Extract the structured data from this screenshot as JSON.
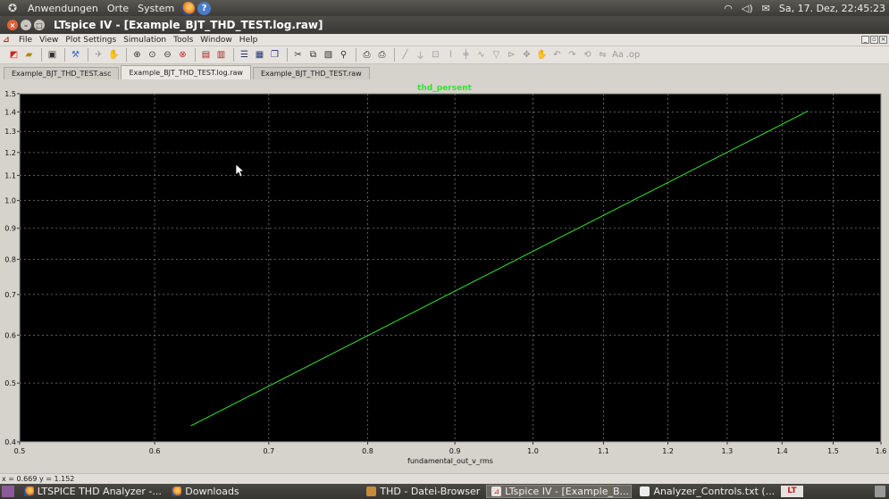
{
  "top_panel": {
    "menus": [
      "Anwendungen",
      "Orte",
      "System"
    ],
    "clock": "Sa, 17. Dez, 22:45:23"
  },
  "window": {
    "title": "LTspice IV - [Example_BJT_THD_TEST.log.raw]"
  },
  "menubar": {
    "items": [
      "File",
      "View",
      "Plot Settings",
      "Simulation",
      "Tools",
      "Window",
      "Help"
    ]
  },
  "tabs": [
    {
      "label": "Example_BJT_THD_TEST.asc",
      "active": false
    },
    {
      "label": "Example_BJT_THD_TEST.log.raw",
      "active": true
    },
    {
      "label": "Example_BJT_THD_TEST.raw",
      "active": false
    }
  ],
  "statusbar": {
    "cursor_readout": "x = 0.669   y = 1.152"
  },
  "taskbar": {
    "tasks": [
      {
        "label": "LTSPICE THD Analyzer -...",
        "active": false
      },
      {
        "label": "Downloads",
        "active": false
      },
      {
        "label": "THD - Datei-Browser",
        "active": false
      },
      {
        "label": "LTspice IV - [Example_B...",
        "active": true
      },
      {
        "label": "Analyzer_Controls.txt (...",
        "active": false
      }
    ]
  },
  "colors": {
    "trace": "#2ee62e",
    "plot_bg": "#000000",
    "grid": "#7a7a7a"
  },
  "chart_data": {
    "type": "line",
    "title": "thd_persent",
    "xlabel": "fundamental_out_v_rms",
    "ylabel": "",
    "xscale": "log",
    "yscale": "log",
    "xlim": [
      0.5,
      1.6
    ],
    "ylim": [
      0.4,
      1.5
    ],
    "x_ticks": [
      0.5,
      0.6,
      0.7,
      0.8,
      0.9,
      1.0,
      1.1,
      1.2,
      1.3,
      1.4,
      1.5,
      1.6
    ],
    "x_tick_labels": [
      "0.5",
      "0.6",
      "0.7",
      "0.8",
      "0.9",
      "1.0",
      "1.1",
      "1.2",
      "1.3",
      "1.4",
      "1.5",
      "1.6"
    ],
    "y_ticks": [
      0.4,
      0.5,
      0.6,
      0.7,
      0.8,
      0.9,
      1.0,
      1.1,
      1.2,
      1.3,
      1.4,
      1.5
    ],
    "y_tick_labels": [
      "0.4",
      "0.5",
      "0.6",
      "0.7",
      "0.8",
      "0.9",
      "1.0",
      "1.1",
      "1.2",
      "1.3",
      "1.4",
      "1.5"
    ],
    "grid": true,
    "series": [
      {
        "x": [
          0.63,
          1.45
        ],
        "y": [
          0.425,
          1.405
        ]
      }
    ]
  }
}
